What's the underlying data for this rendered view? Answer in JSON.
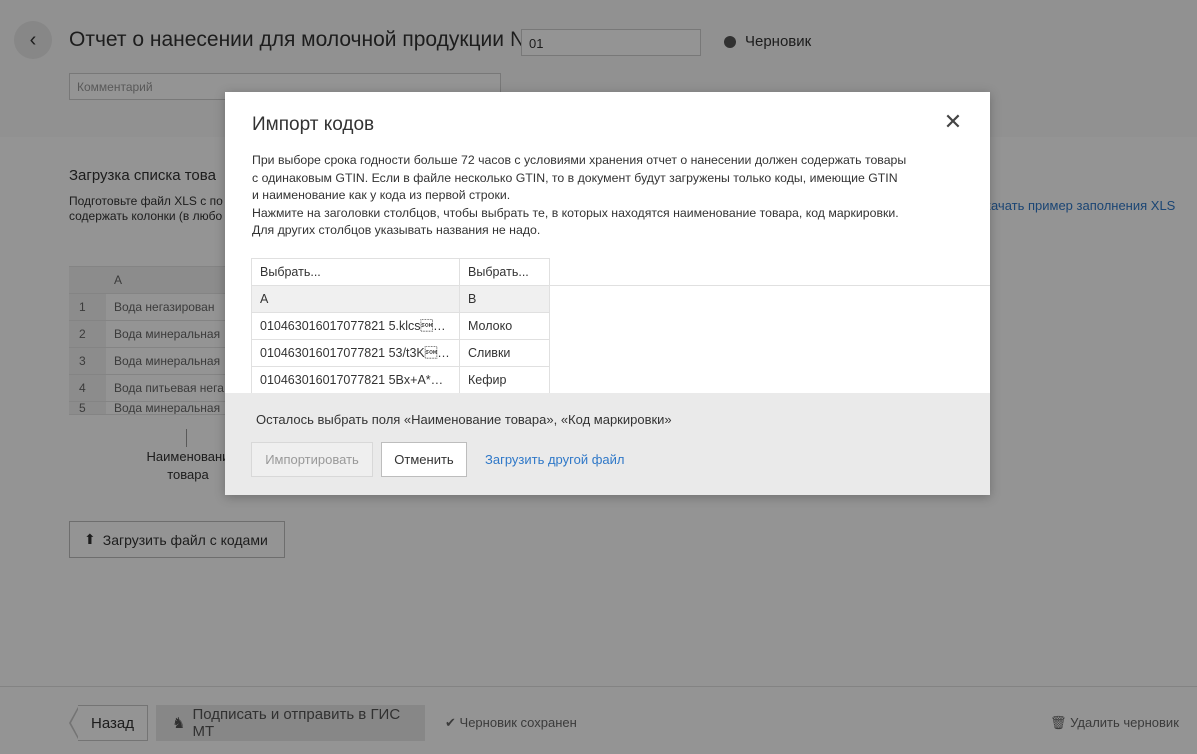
{
  "page": {
    "title": "Отчет о нанесении для молочной продукции №",
    "number_value": "01",
    "status": "Черновик",
    "comment_placeholder": "Комментарий",
    "section_title": "Загрузка списка това",
    "section_desc": "Подготовьте файл XLS с по содержать колонки (в любо",
    "xls_link": "качать пример заполнения XLS",
    "bg_table": {
      "header": "A",
      "rows": [
        {
          "idx": "1",
          "value": "Вода негазирован"
        },
        {
          "idx": "2",
          "value": "Вода минеральная"
        },
        {
          "idx": "3",
          "value": "Вода минеральная"
        },
        {
          "idx": "4",
          "value": "Вода питьевая нега"
        },
        {
          "idx": "5",
          "value": "Вода минеральная"
        }
      ]
    },
    "bg_colname": "Наименовани товара",
    "upload_button": "Загрузить файл с кодами"
  },
  "footer": {
    "back": "Назад",
    "sign": "Подписать и отправить в ГИС МТ",
    "saved": "Черновик сохранен",
    "delete": "Удалить черновик"
  },
  "modal": {
    "title": "Импорт кодов",
    "close_icon": "close-icon",
    "text_lines": [
      "При выборе срока годности больше 72 часов с условиями хранения отчет о нанесении должен содержать товары",
      "с одинаковым GTIN. Если в файле несколько GTIN, то в документ будут загружены только коды, имеющие GTIN",
      "и наименование как у кода из первой строки.",
      "Нажмите на заголовки столбцов, чтобы выбрать те, в которых находятся наименование товара, код маркировки.",
      "Для других столбцов указывать названия не надо."
    ],
    "table": {
      "select_headers": [
        "Выбрать...",
        "Выбрать..."
      ],
      "letters": [
        "A",
        "B"
      ],
      "rows": [
        [
          "010463016017077821 5.klcs\u000193d...",
          "Молоко"
        ],
        [
          "010463016017077821 53/t3K\u000193...",
          "Сливки"
        ],
        [
          "010463016017077821 5Bx+A*\u00019...",
          "Кефир"
        ]
      ]
    },
    "remaining": "Осталось выбрать поля «Наименование товара», «Код маркировки»",
    "import_button": "Импортировать",
    "cancel_button": "Отменить",
    "other_file_link": "Загрузить другой файл"
  }
}
